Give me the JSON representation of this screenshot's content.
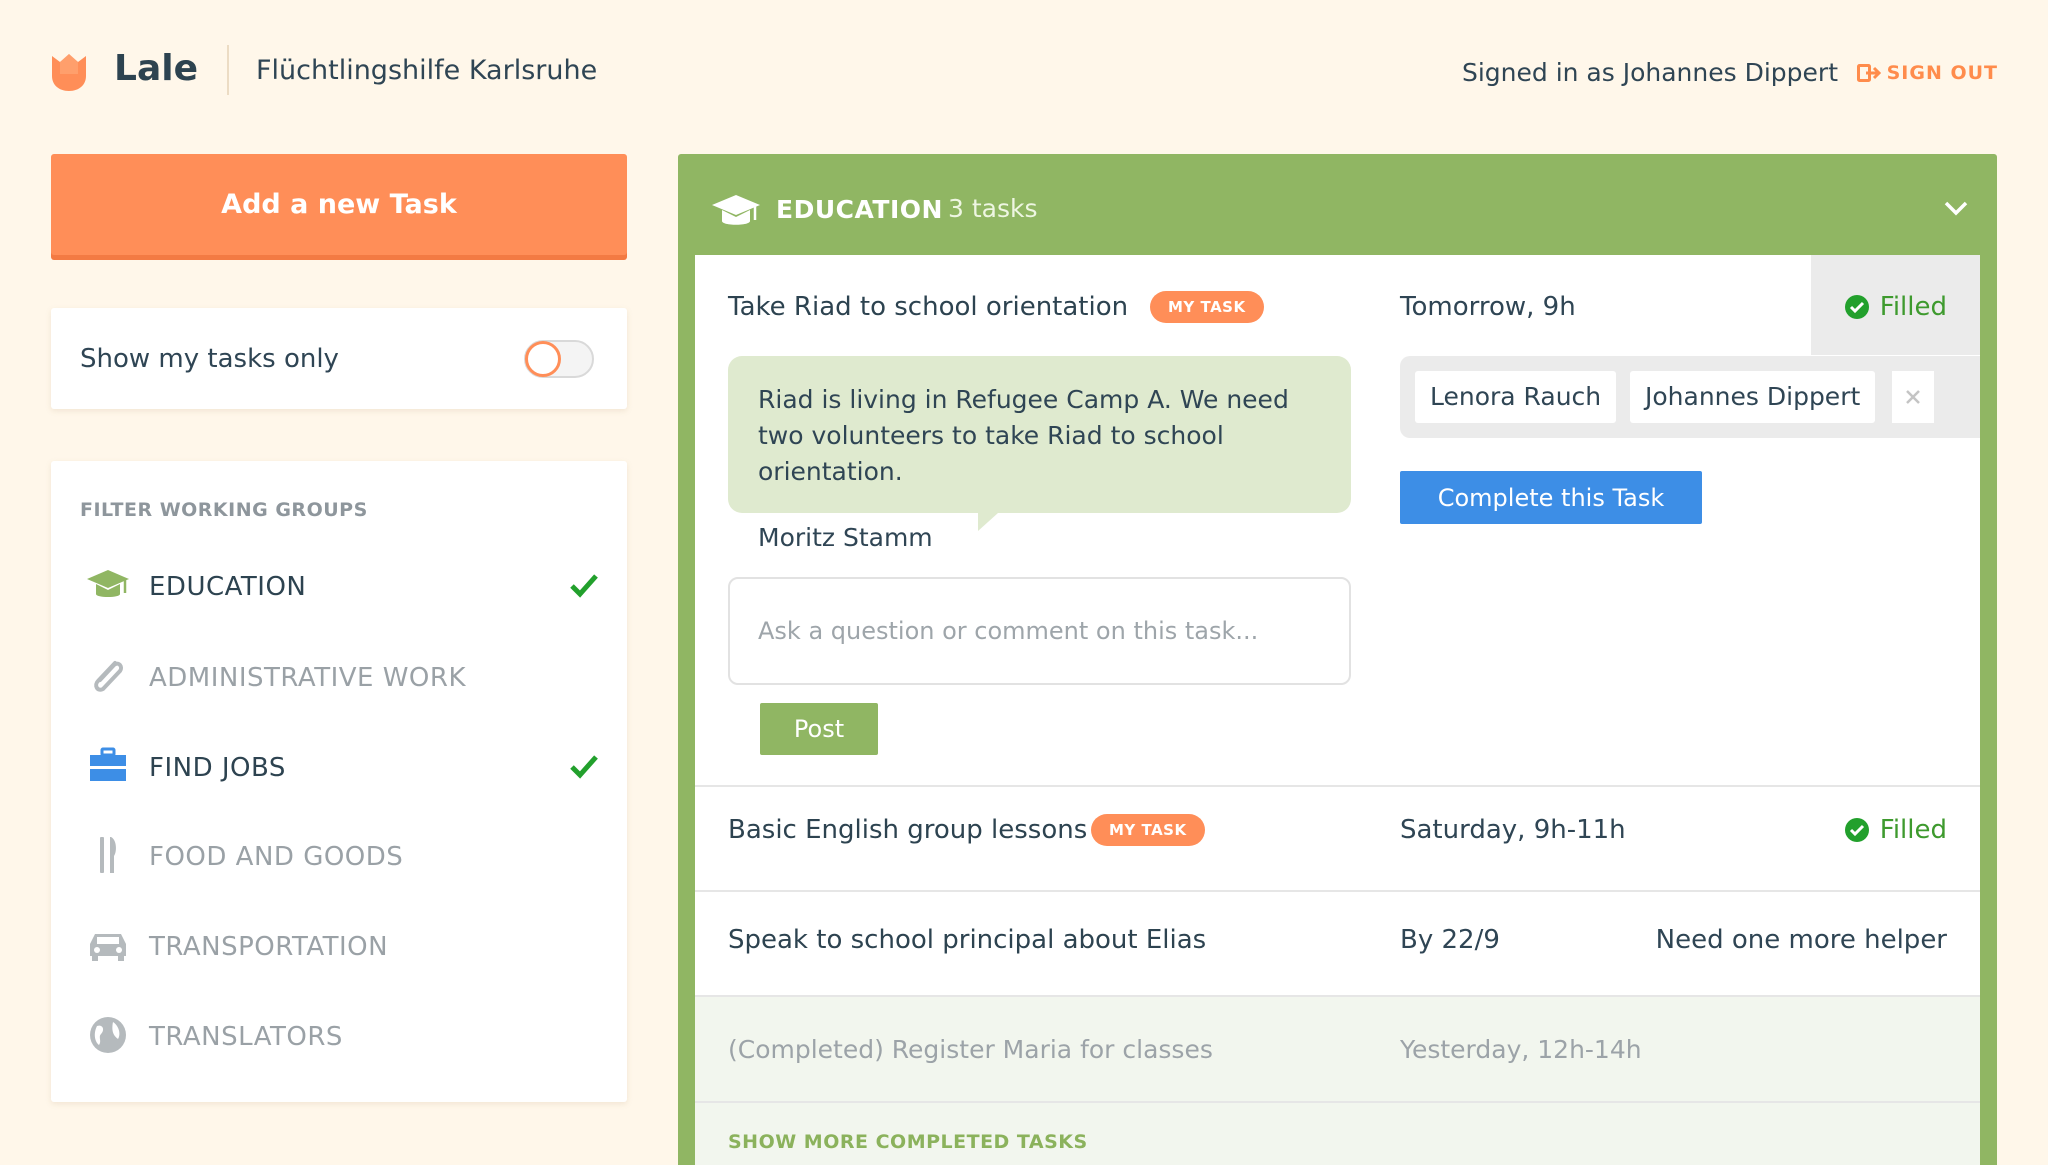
{
  "header": {
    "app_name": "Lale",
    "org_name": "Flüchtlingshilfe Karlsruhe",
    "signed_in": "Signed in as Johannes Dippert",
    "sign_out": "SIGN OUT"
  },
  "sidebar": {
    "add_task_label": "Add a new Task",
    "toggle_label": "Show my tasks only",
    "toggle_on": false,
    "filter_title": "FILTER WORKING GROUPS",
    "groups": [
      {
        "label": "EDUCATION",
        "icon": "graduation-cap-icon",
        "checked": true
      },
      {
        "label": "ADMINISTRATIVE WORK",
        "icon": "paperclip-icon",
        "checked": false
      },
      {
        "label": "FIND JOBS",
        "icon": "briefcase-icon",
        "checked": true
      },
      {
        "label": "FOOD AND GOODS",
        "icon": "fork-knife-icon",
        "checked": false
      },
      {
        "label": "TRANSPORTATION",
        "icon": "car-icon",
        "checked": false
      },
      {
        "label": "TRANSLATORS",
        "icon": "globe-icon",
        "checked": false
      }
    ]
  },
  "panel": {
    "title": "EDUCATION",
    "count": "3 tasks",
    "tasks": [
      {
        "title": "Take Riad to school orientation",
        "badge": "MY TASK",
        "date": "Tomorrow, 9h",
        "status": "Filled",
        "description": "Riad is living in Refugee Camp A. We need two volunteers to take Riad to school orientation.",
        "author": "Moritz Stamm",
        "comment_placeholder": "Ask a question or comment on this task...",
        "post_label": "Post",
        "helpers": [
          "Lenora Rauch",
          "Johannes Dippert"
        ],
        "complete_label": "Complete this Task"
      },
      {
        "title": "Basic English group lessons",
        "badge": "MY TASK",
        "date": "Saturday, 9h-11h",
        "status": "Filled"
      },
      {
        "title": "Speak to school principal about Elias",
        "date": "By 22/9",
        "status": "Need one more helper"
      }
    ],
    "completed": {
      "title": "(Completed) Register Maria for classes",
      "date": "Yesterday, 12h-14h"
    },
    "show_more": "SHOW MORE COMPLETED TASKS"
  },
  "colors": {
    "accent_orange": "#ff8e58",
    "education_green": "#90b663",
    "primary_blue": "#3d8ee6",
    "filled_green": "#3e9a2e",
    "background": "#fff7ea"
  }
}
